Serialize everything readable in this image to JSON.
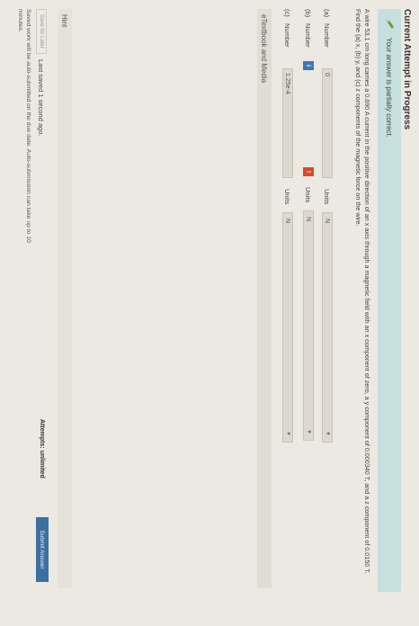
{
  "header": {
    "title": "Current Attempt in Progress"
  },
  "banner": {
    "icon": "pencil-icon",
    "text": "Your answer is partially correct."
  },
  "question": {
    "text": "A wire 53.1 cm long carries a 0.690 A current in the positive direction of an x axis through a magnetic field with an x component of zero, a y component of 0.000340 T, and a z component of 0.0150 T. Find the (a) x, (b) y, and (c) z components of the magnetic force on the wire."
  },
  "parts": [
    {
      "label": "(a)",
      "number_label": "Number",
      "value": "0",
      "indicator": "",
      "units_label": "Units",
      "unit": "N"
    },
    {
      "label": "(b)",
      "number_label": "Number",
      "value": "",
      "indicator": "i",
      "units_label": "Units",
      "unit": "N"
    },
    {
      "label": "(c)",
      "number_label": "Number",
      "value": "1.25e-4",
      "indicator": "",
      "units_label": "Units",
      "unit": "N"
    }
  ],
  "sections": {
    "etextbook": "eTextbook and Media",
    "hint": "Hint"
  },
  "footer": {
    "save_later": "Save for Later",
    "last_saved": "Last saved 1 second ago.",
    "autosave": "Saved work will be auto-submitted on the due date. Auto-submission can take up to 10 minutes.",
    "attempts": "Attempts: unlimited",
    "submit": "Submit Answer"
  },
  "colors": {
    "banner_bg": "#c6dfdf",
    "submit_bg": "#3d6fa0",
    "info_indicator": "#3c78b4",
    "error_indicator": "#d94a2a"
  }
}
